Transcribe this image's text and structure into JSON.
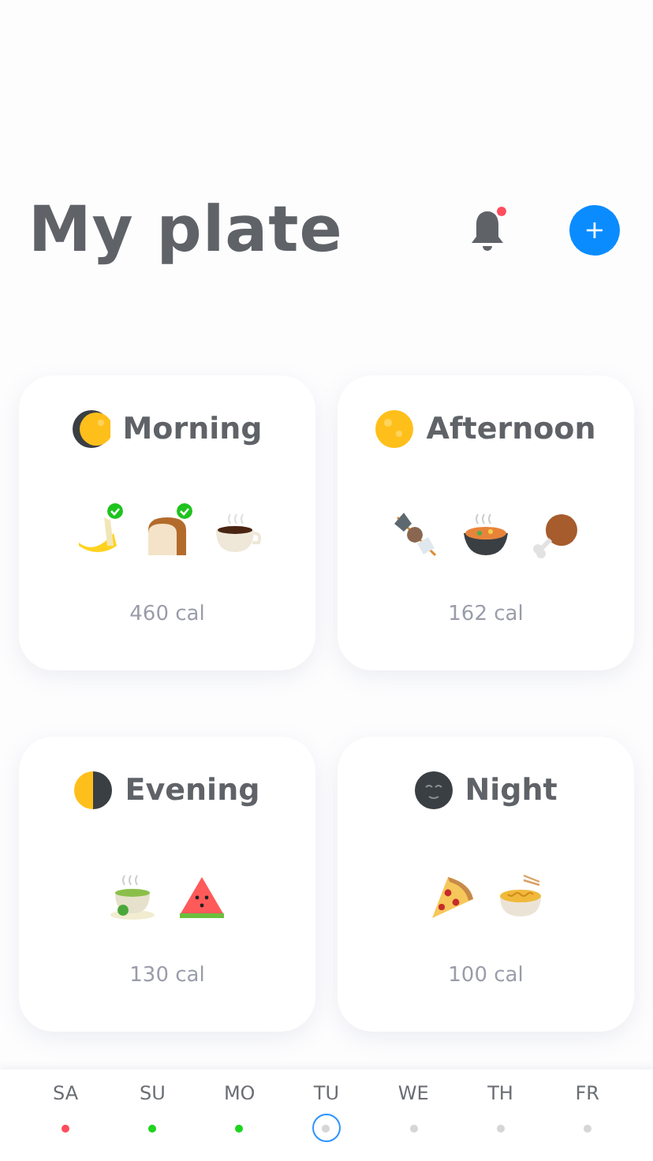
{
  "header": {
    "title": "My plate",
    "notification": {
      "unread": true
    },
    "add_button": {
      "label": "+"
    }
  },
  "meals": [
    {
      "name": "Morning",
      "kind": "crescent",
      "calories": "460 cal",
      "foods": [
        {
          "kind": "banana",
          "checked": true
        },
        {
          "kind": "bread",
          "checked": true
        },
        {
          "kind": "coffee",
          "checked": false
        }
      ]
    },
    {
      "name": "Afternoon",
      "kind": "full",
      "calories": "162 cal",
      "foods": [
        {
          "kind": "skewer",
          "checked": false
        },
        {
          "kind": "stew",
          "checked": false
        },
        {
          "kind": "drumstick",
          "checked": false
        }
      ]
    },
    {
      "name": "Evening",
      "kind": "half",
      "calories": "130 cal",
      "foods": [
        {
          "kind": "tea",
          "checked": false
        },
        {
          "kind": "watermelon",
          "checked": false
        }
      ]
    },
    {
      "name": "Night",
      "kind": "new",
      "calories": "100 cal",
      "foods": [
        {
          "kind": "pizza",
          "checked": false
        },
        {
          "kind": "noodles",
          "checked": false
        }
      ]
    }
  ],
  "days": [
    {
      "label": "SA",
      "color": "#ff4d5e",
      "selected": false
    },
    {
      "label": "SU",
      "color": "#1ed41e",
      "selected": false
    },
    {
      "label": "MO",
      "color": "#1ed41e",
      "selected": false
    },
    {
      "label": "TU",
      "color": "#d6d6d6",
      "selected": true
    },
    {
      "label": "WE",
      "color": "#d6d6d6",
      "selected": false
    },
    {
      "label": "TH",
      "color": "#d6d6d6",
      "selected": false
    },
    {
      "label": "FR",
      "color": "#d6d6d6",
      "selected": false
    }
  ]
}
